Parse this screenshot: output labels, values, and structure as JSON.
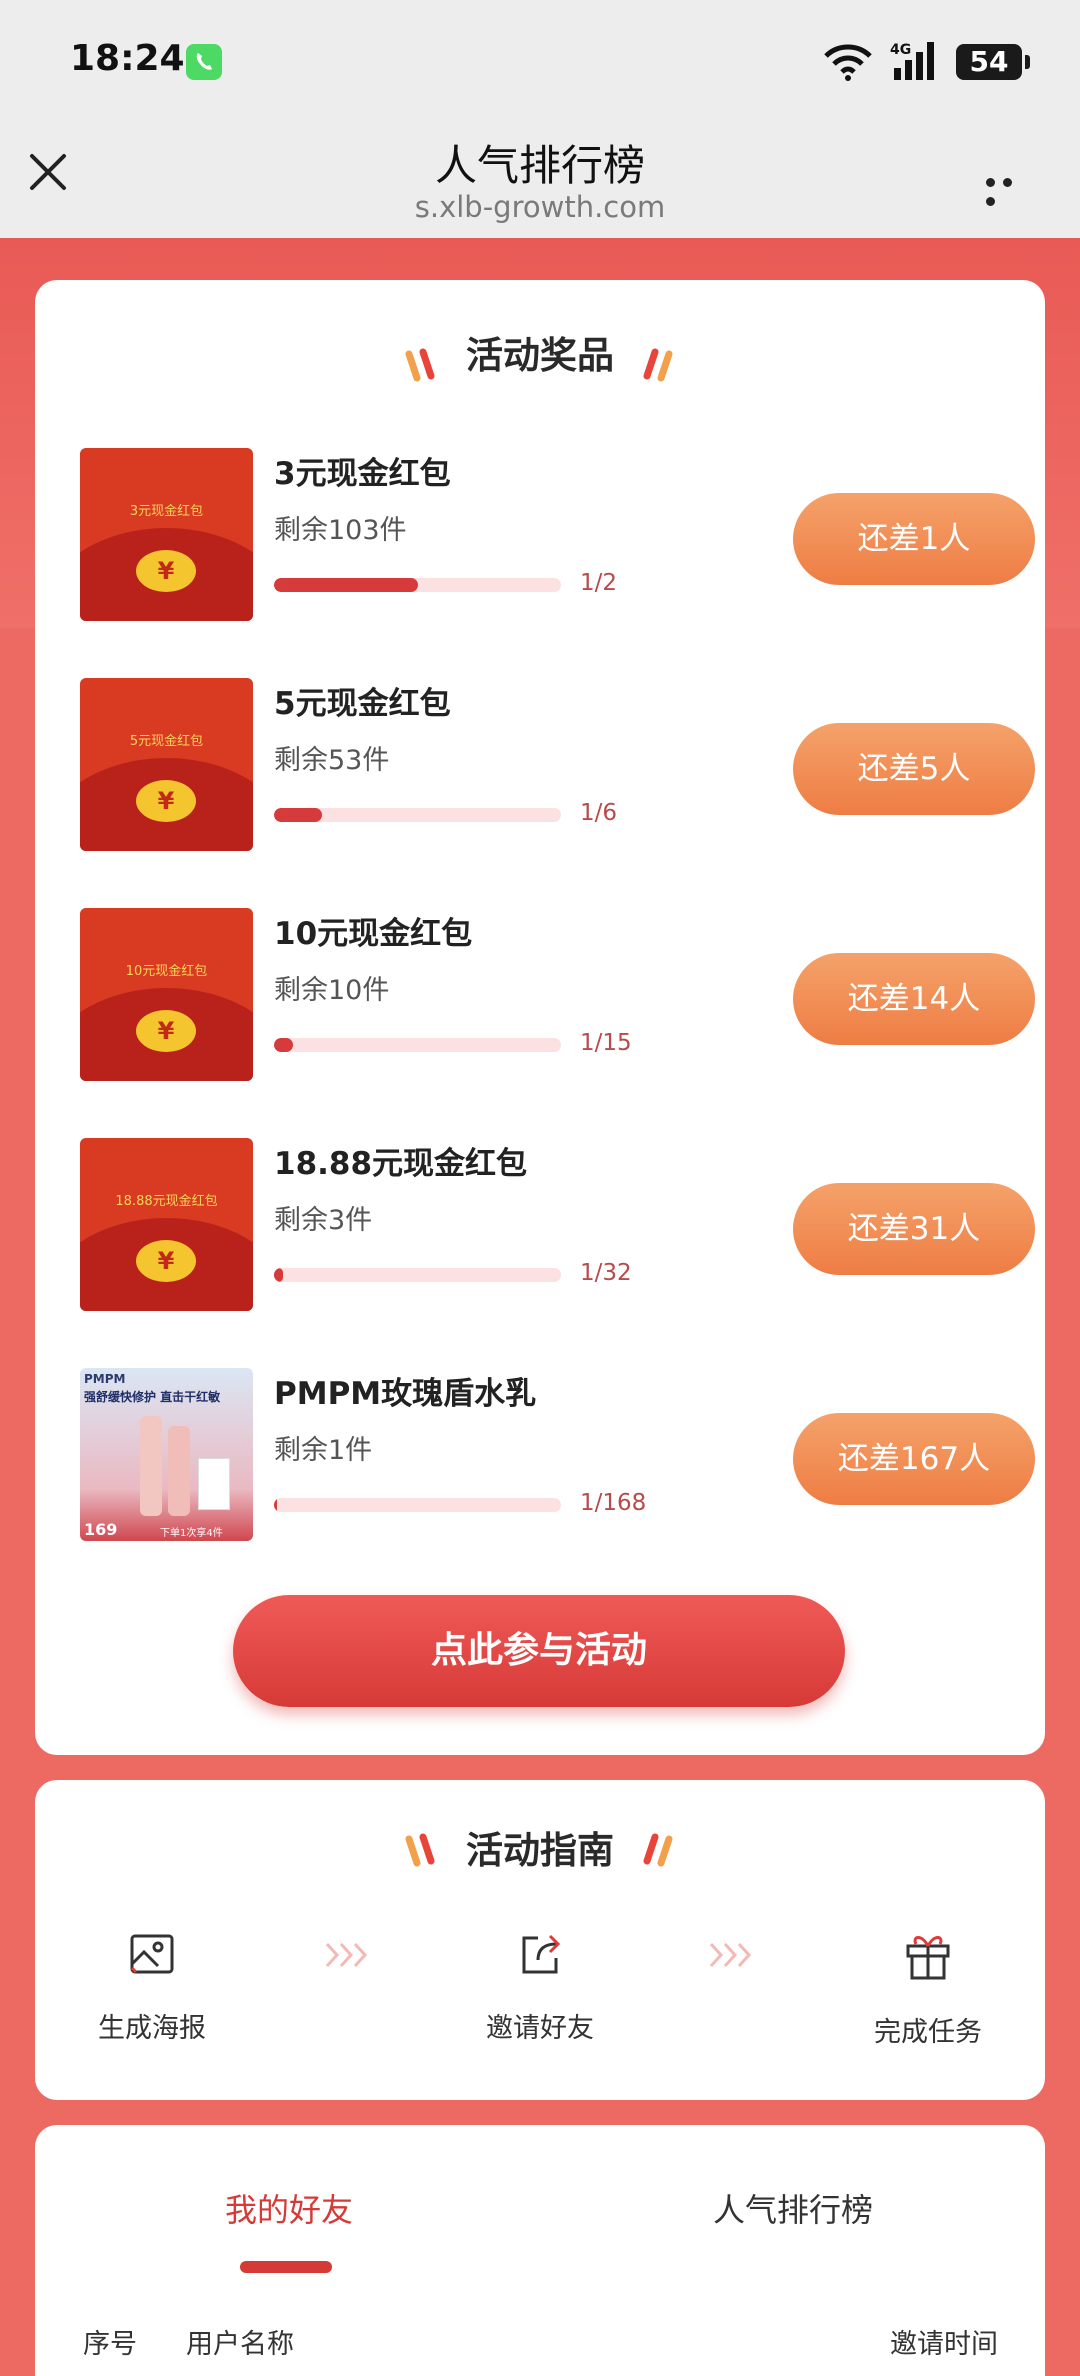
{
  "status_bar": {
    "time": "18:24",
    "network": "4G",
    "battery": "54"
  },
  "nav": {
    "title": "人气排行榜",
    "subtitle": "s.xlb-growth.com"
  },
  "prizes_section": {
    "heading": "活动奖品",
    "items": [
      {
        "name": "3元现金红包",
        "image_label": "3元现金红包",
        "remaining": "剩余103件",
        "progress_text": "1/2",
        "progress": 0.5,
        "button": "还差1人"
      },
      {
        "name": "5元现金红包",
        "image_label": "5元现金红包",
        "remaining": "剩余53件",
        "progress_text": "1/6",
        "progress": 0.1667,
        "button": "还差5人"
      },
      {
        "name": "10元现金红包",
        "image_label": "10元现金红包",
        "remaining": "剩余10件",
        "progress_text": "1/15",
        "progress": 0.0667,
        "button": "还差14人"
      },
      {
        "name": "18.88元现金红包",
        "image_label": "18.88元现金红包",
        "remaining": "剩余3件",
        "progress_text": "1/32",
        "progress": 0.03125,
        "button": "还差31人"
      },
      {
        "name": "PMPM玫瑰盾水乳",
        "image_label": "PMPM",
        "image_headline": "强舒缓快修护 直击干红敏",
        "image_price": "169",
        "image_footer": "下单1次享4件",
        "remaining": "剩余1件",
        "progress_text": "1/168",
        "progress": 0.006,
        "button": "还差167人"
      }
    ],
    "coin_symbol": "¥",
    "join_button": "点此参与活动"
  },
  "guide_section": {
    "heading": "活动指南",
    "steps": [
      {
        "label": "生成海报",
        "icon": "image-icon"
      },
      {
        "label": "邀请好友",
        "icon": "share-icon"
      },
      {
        "label": "完成任务",
        "icon": "gift-icon"
      }
    ]
  },
  "friends_section": {
    "tabs": [
      "我的好友",
      "人气排行榜"
    ],
    "active_tab": 0,
    "columns": [
      "序号",
      "用户名称",
      "邀请时间"
    ]
  },
  "colors": {
    "primary_red": "#d63a37",
    "button_orange": "#ee7d44",
    "background": "#ec6a62"
  }
}
